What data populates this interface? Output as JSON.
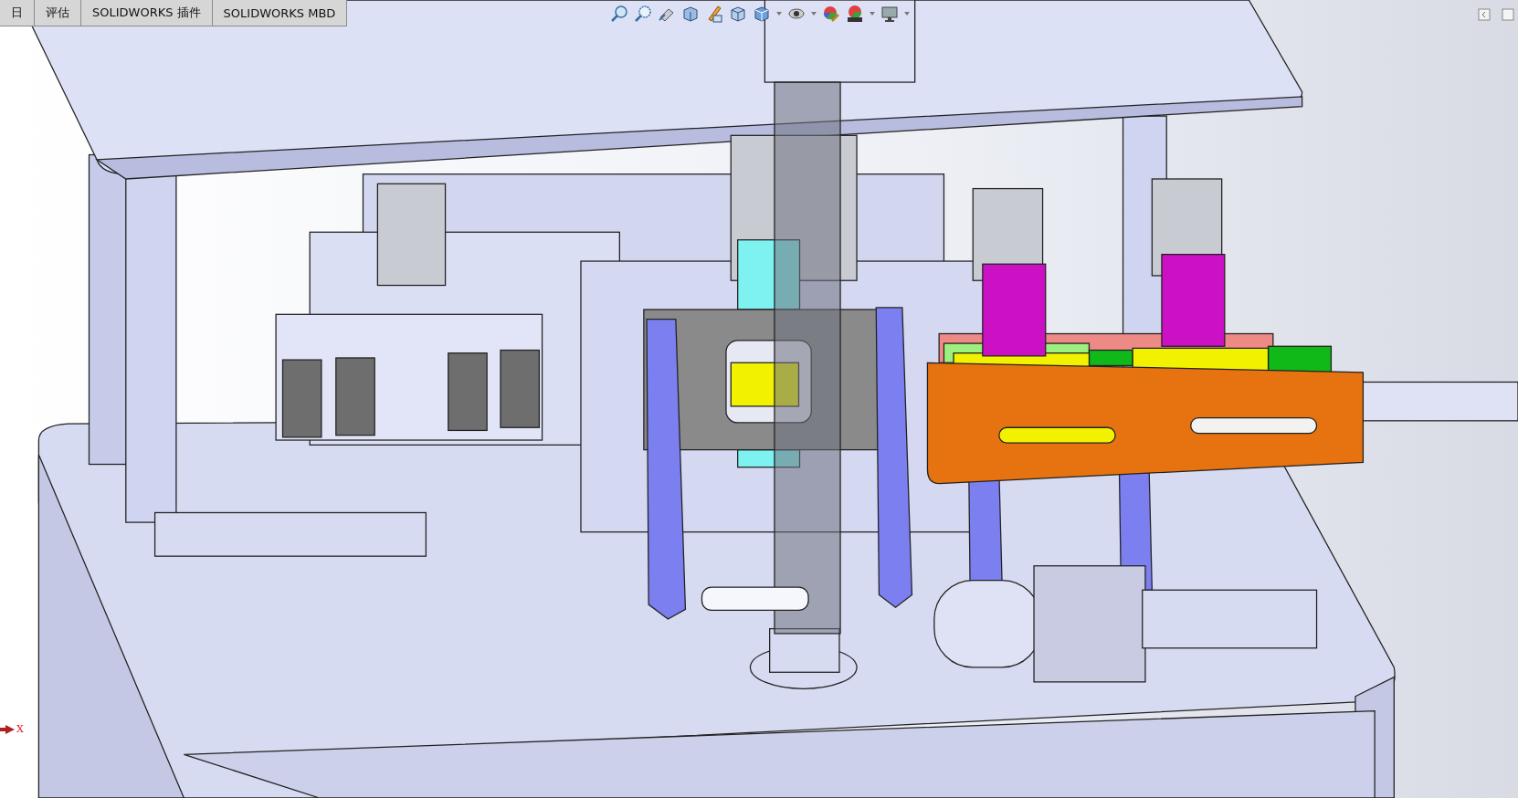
{
  "tabs": [
    {
      "label": "日"
    },
    {
      "label": "评估"
    },
    {
      "label": "SOLIDWORKS 插件"
    },
    {
      "label": "SOLIDWORKS MBD"
    }
  ],
  "axis": {
    "label": "X"
  }
}
